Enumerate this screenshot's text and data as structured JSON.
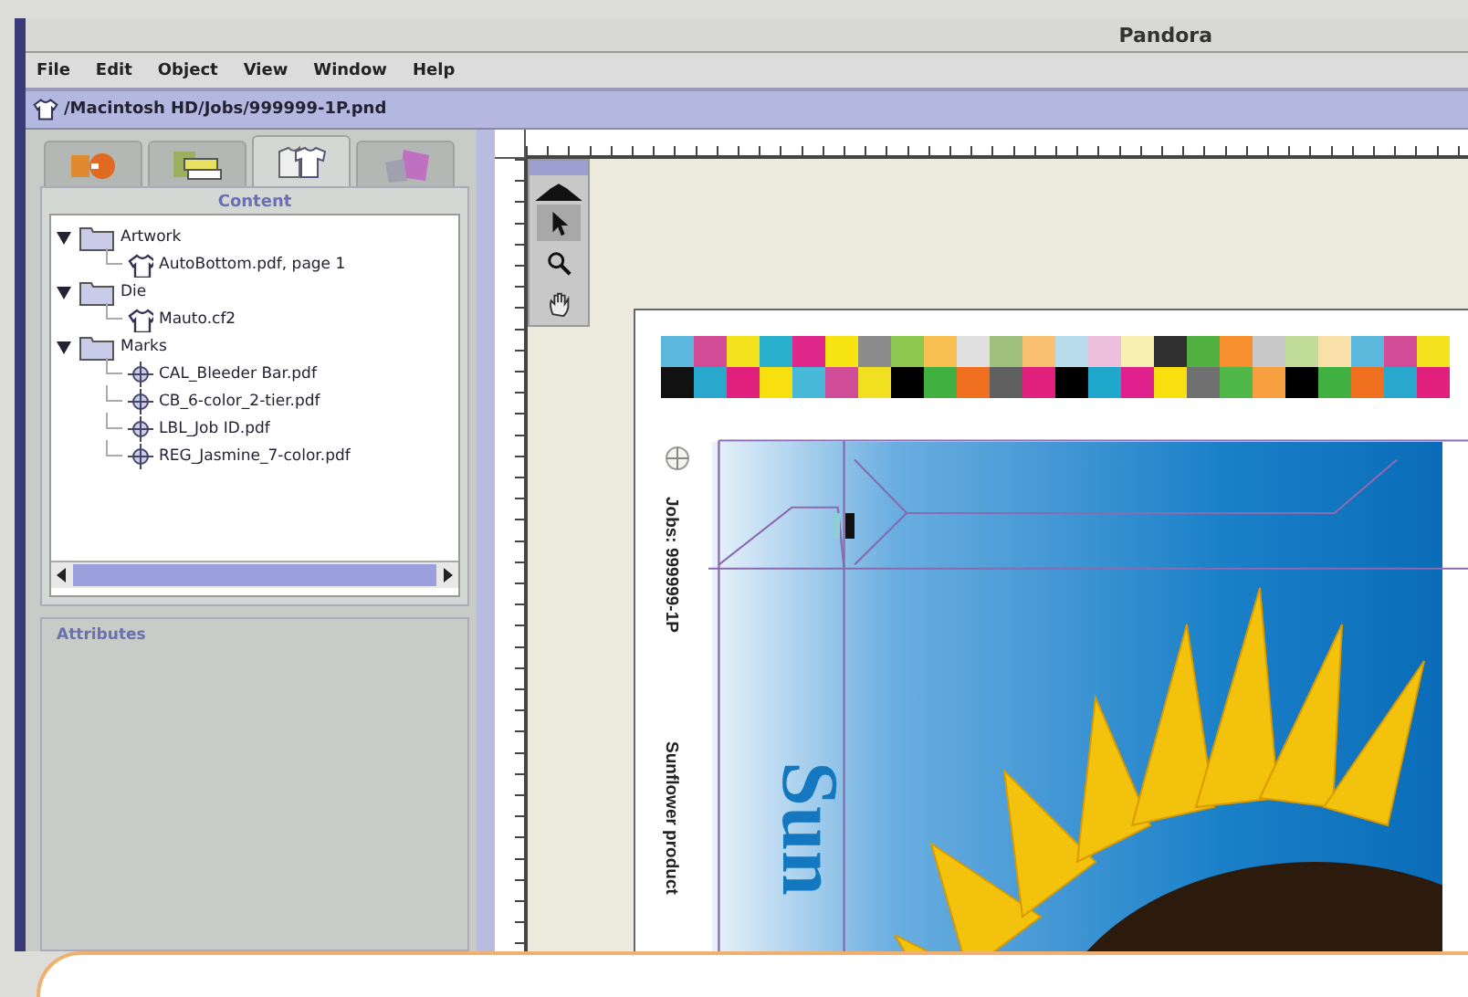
{
  "window": {
    "title": "Pandora"
  },
  "menu": [
    "File",
    "Edit",
    "Object",
    "View",
    "Window",
    "Help"
  ],
  "path": "/Macintosh HD/Jobs/999999-1P.pnd",
  "tabs": [
    {
      "kind": "shapes",
      "selected": false
    },
    {
      "kind": "layers",
      "selected": false
    },
    {
      "kind": "shirts",
      "selected": true
    },
    {
      "kind": "sheets",
      "selected": false
    }
  ],
  "content_panel": {
    "title": "Content",
    "tree": [
      {
        "label": "Artwork",
        "kind": "folder",
        "expanded": true,
        "children": [
          {
            "label": "AutoBottom.pdf, page 1",
            "kind": "shirt"
          }
        ]
      },
      {
        "label": "Die",
        "kind": "folder",
        "expanded": true,
        "children": [
          {
            "label": "Mauto.cf2",
            "kind": "shirt"
          }
        ]
      },
      {
        "label": "Marks",
        "kind": "folder",
        "expanded": true,
        "children": [
          {
            "label": "CAL_Bleeder Bar.pdf",
            "kind": "mark"
          },
          {
            "label": "CB_6-color_2-tier.pdf",
            "kind": "mark"
          },
          {
            "label": "LBL_Job ID.pdf",
            "kind": "mark"
          },
          {
            "label": "REG_Jasmine_7-color.pdf",
            "kind": "mark"
          }
        ]
      }
    ]
  },
  "attributes_panel": {
    "title": "Attributes"
  },
  "tools": [
    {
      "kind": "arrow",
      "selected": true
    },
    {
      "kind": "zoom",
      "selected": false
    },
    {
      "kind": "hand",
      "selected": false
    }
  ],
  "page": {
    "job_label": "Jobs: 999999-1P",
    "product_label": "Sunflower product",
    "headline": "Sun"
  }
}
